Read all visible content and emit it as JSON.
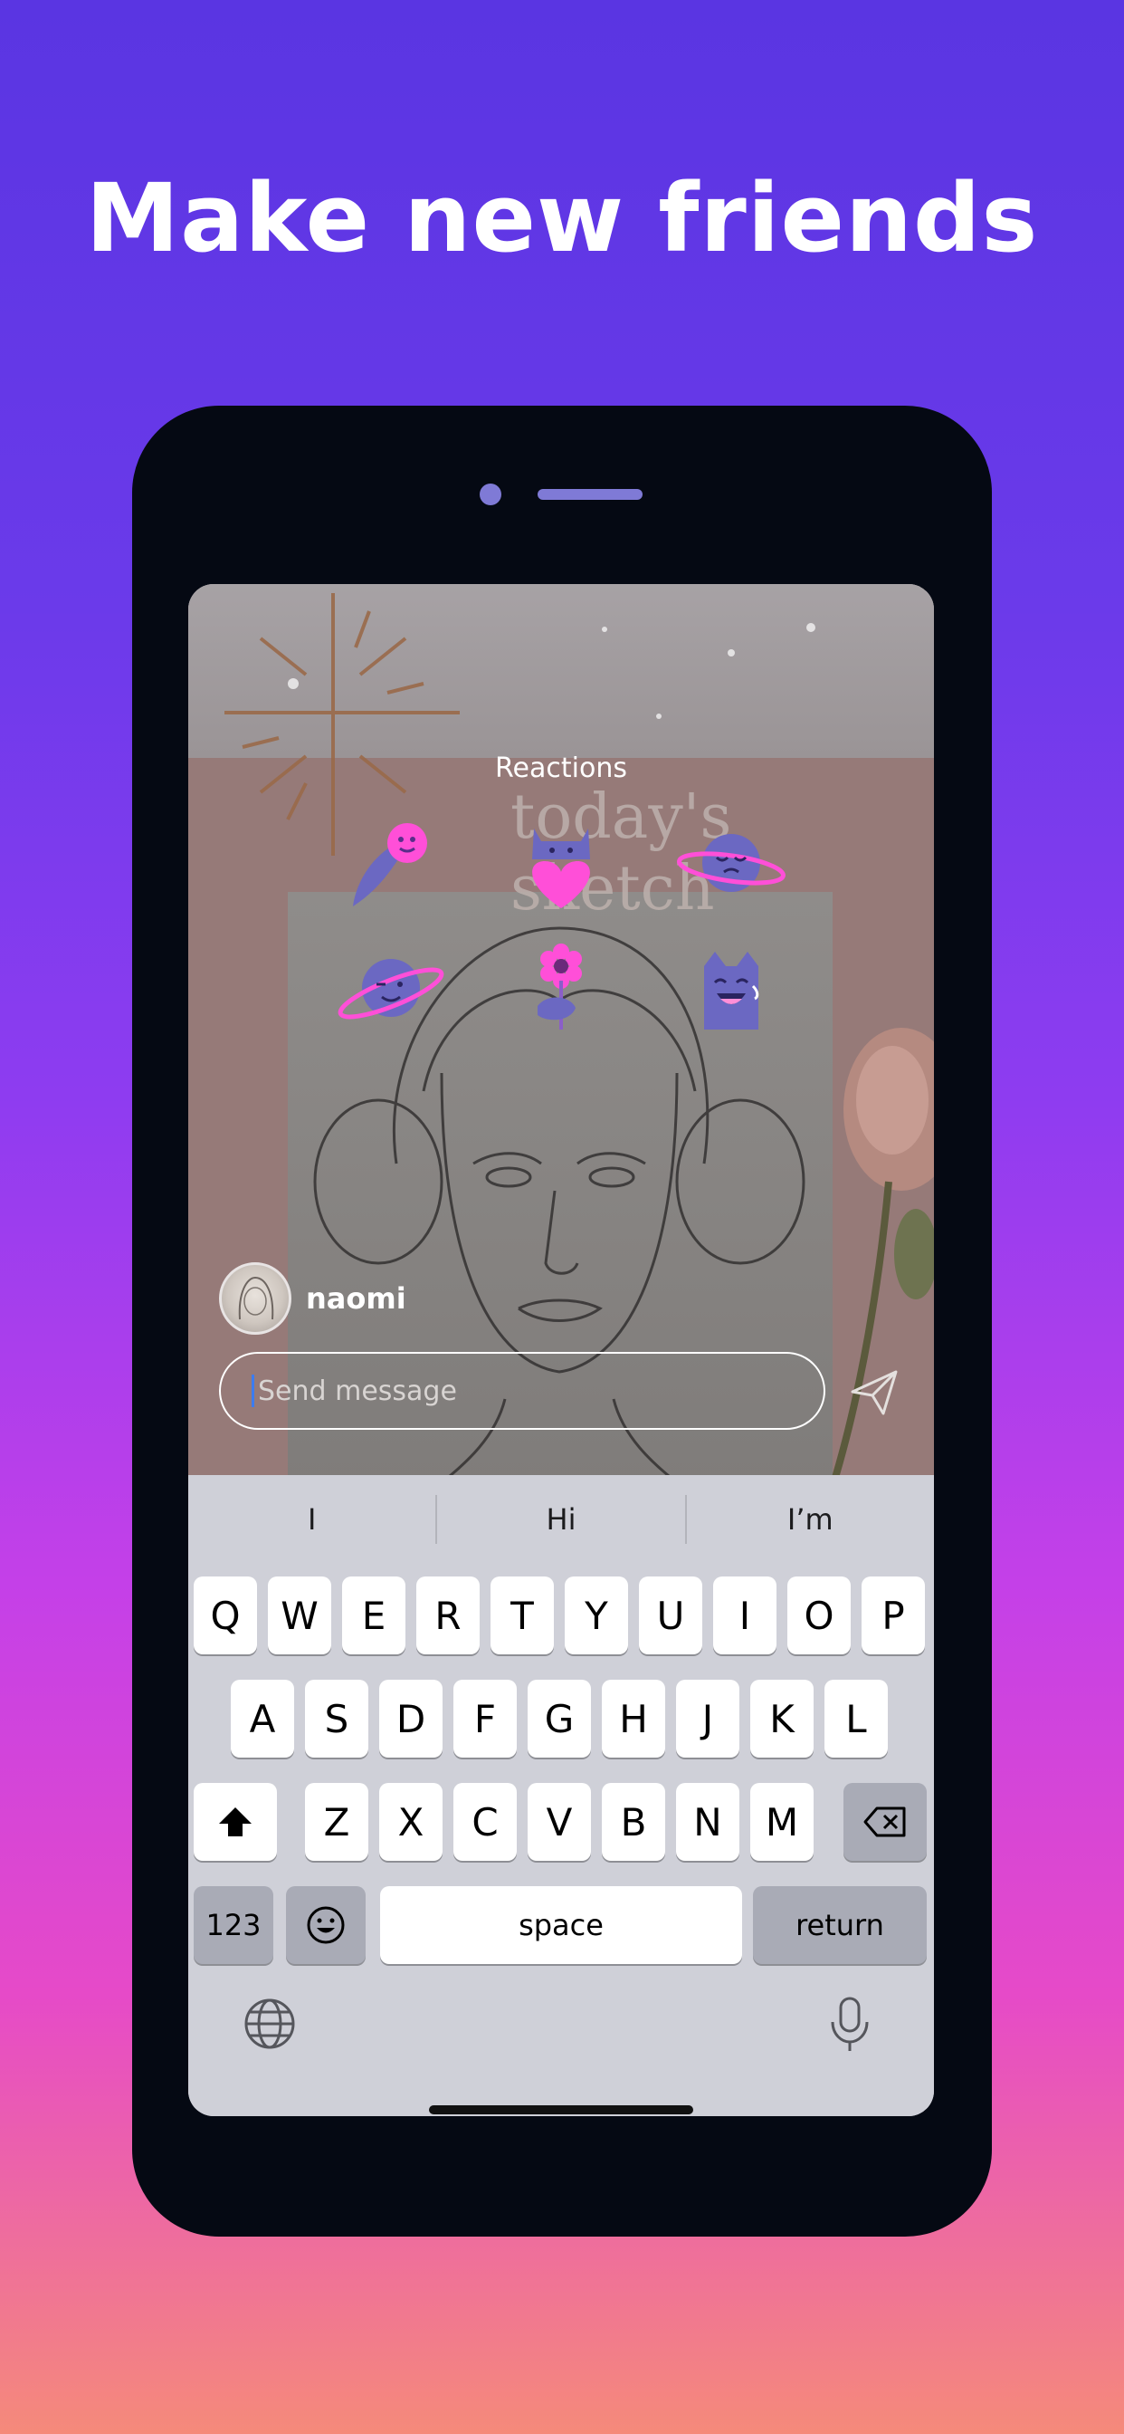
{
  "headline": "Make new friends",
  "story": {
    "sketch_title": "today's sketch",
    "reactions_title": "Reactions",
    "reactions": [
      "comet-reaction",
      "heart-cat-reaction",
      "planet-sleepy-reaction",
      "planet-wink-reaction",
      "flower-reaction",
      "laughing-cat-reaction"
    ],
    "username": "naomi",
    "message_placeholder": "Send message"
  },
  "keyboard": {
    "suggestions": [
      "I",
      "Hi",
      "I’m"
    ],
    "row1": [
      "Q",
      "W",
      "E",
      "R",
      "T",
      "Y",
      "U",
      "I",
      "O",
      "P"
    ],
    "row2": [
      "A",
      "S",
      "D",
      "F",
      "G",
      "H",
      "J",
      "K",
      "L"
    ],
    "row3": [
      "Z",
      "X",
      "C",
      "V",
      "B",
      "N",
      "M"
    ],
    "numbers_label": "123",
    "space_label": "space",
    "return_label": "return"
  },
  "colors": {
    "accent_pink": "#ff4fd8",
    "reaction_purple": "#6b68c2",
    "phone_body": "#050913"
  }
}
